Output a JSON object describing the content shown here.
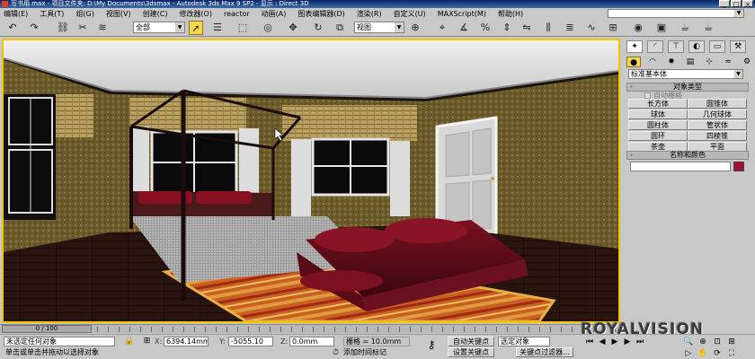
{
  "window": {
    "title": "写书用.max  - 项目文件夹: D:\\My Documents\\3dsmax  - Autodesk 3ds Max 9 SP2  - 显示 : Direct 3D",
    "btn_min": "_",
    "btn_max": "□",
    "btn_close": "×"
  },
  "menu": [
    "编辑(E)",
    "工具(T)",
    "组(G)",
    "视图(V)",
    "创建(C)",
    "修改器(O)",
    "reactor",
    "动画(A)",
    "图表编辑器(D)",
    "渲染(R)",
    "自定义(U)",
    "MAXScript(M)",
    "帮助(H)"
  ],
  "toolbar": {
    "selection_filter": "全部",
    "ref_coord": "视图",
    "icons": [
      "undo-icon",
      "redo-icon",
      "link-icon",
      "unlink-icon",
      "bind-space-warp-icon",
      "select-object-icon",
      "select-by-name-icon",
      "rect-selection-icon",
      "window-crossing-icon",
      "move-icon",
      "rotate-icon",
      "scale-icon",
      "pivot-icon",
      "mirror-icon",
      "align-icon",
      "layer-icon",
      "curve-editor-icon",
      "schematic-icon",
      "material-editor-icon",
      "render-scene-icon",
      "quick-render-icon"
    ]
  },
  "command_panel": {
    "primitive_type": "标准基本体",
    "object_type_title": "对象类型",
    "autogrid": "自动栅格",
    "objects": [
      "长方体",
      "圆锥体",
      "球体",
      "几何球体",
      "圆柱体",
      "管状体",
      "圆环",
      "四棱锥",
      "茶壶",
      "平面"
    ],
    "name_color_title": "名称和颜色",
    "object_color": "#a01030",
    "rollout_toggle": "-"
  },
  "timeline": {
    "frame": "0 / 100"
  },
  "status": {
    "selection": "未选定任何对象",
    "prompt": "单击或单击并拖动以选择对象",
    "x_label": "X:",
    "x_value": "6394.14mm",
    "y_label": "Y:",
    "y_value": "-5055.10",
    "z_label": "Z:",
    "z_value": "0.0mm",
    "grid": "栅格 = 10.0mm",
    "add_time_tag": "添加时间标记",
    "auto_key": "自动关键点",
    "set_key": "设置关键点",
    "key_filter_value": "选定对象",
    "key_filters": "关键点过滤器..."
  },
  "logo": "ROYALVISION"
}
